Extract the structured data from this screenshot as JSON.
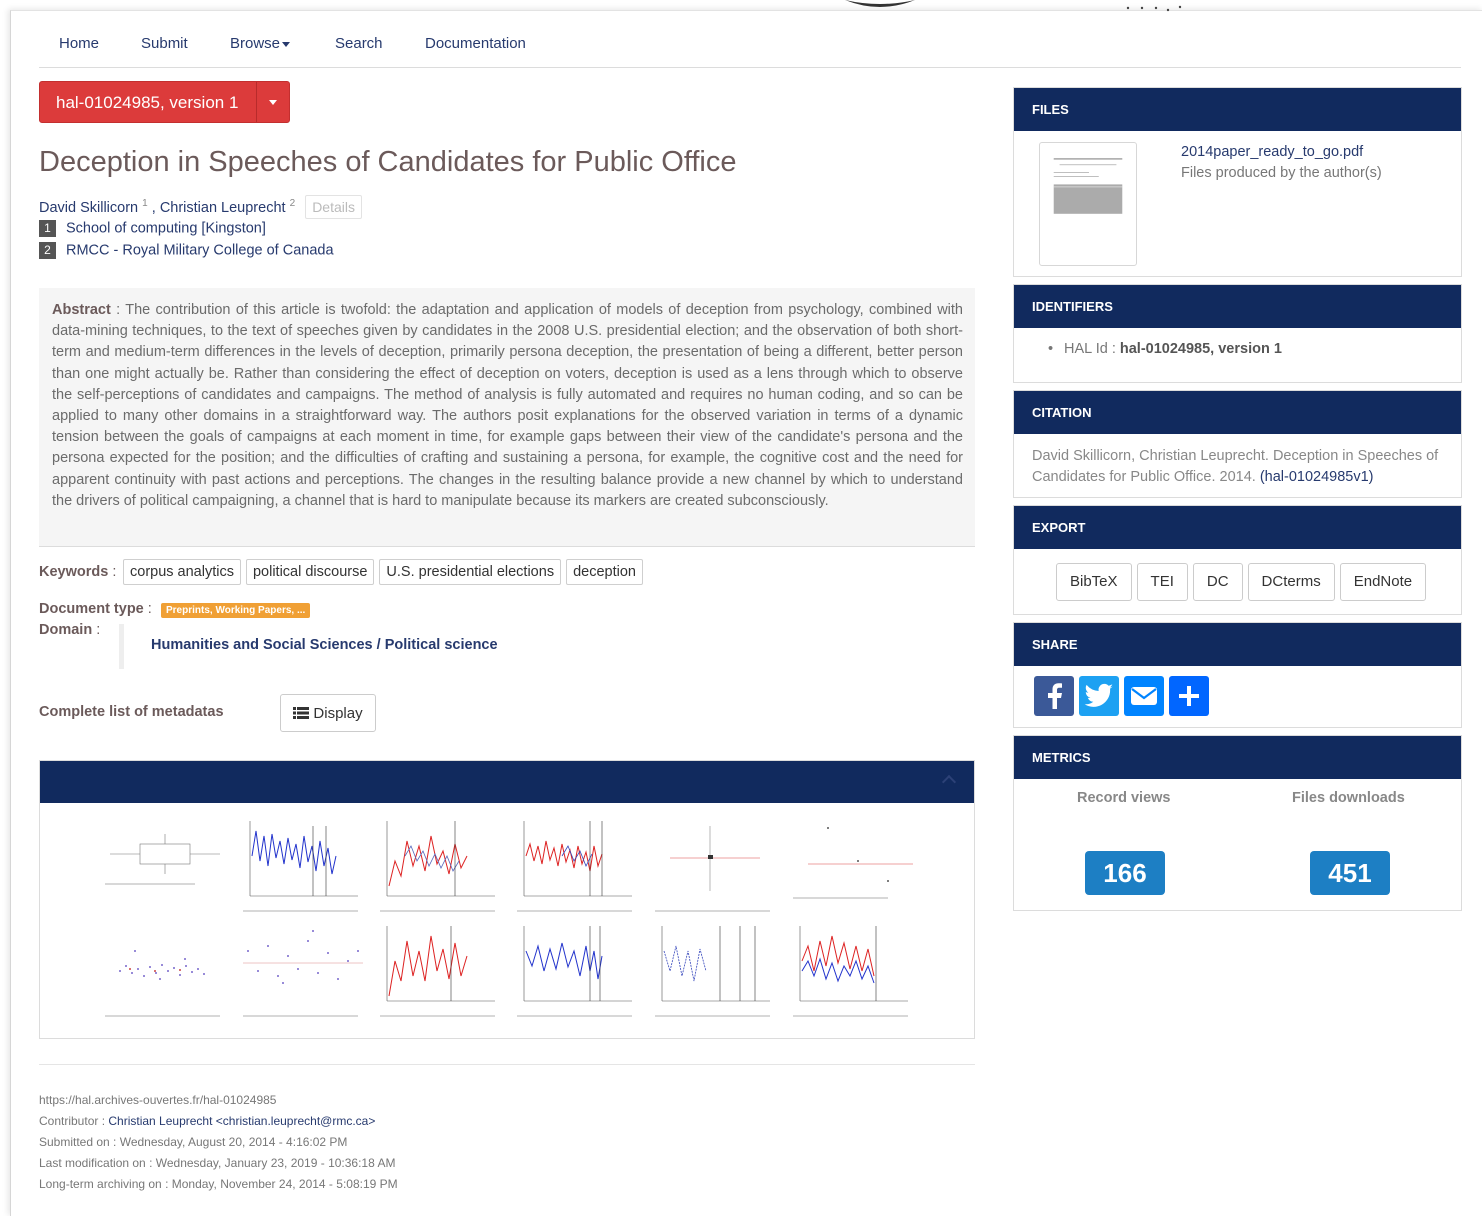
{
  "nav": {
    "home": "Home",
    "submit": "Submit",
    "browse": "Browse",
    "search": "Search",
    "documentation": "Documentation"
  },
  "version_button": "hal-01024985, version 1",
  "title": "Deception in Speeches of Candidates for Public Office",
  "authors": [
    {
      "name": "David Skillicorn",
      "sup": "1"
    },
    {
      "name": "Christian Leuprecht",
      "sup": "2"
    }
  ],
  "authors_sep": " , ",
  "details_label": "Details",
  "affiliations": [
    {
      "num": "1",
      "name": "School of computing [Kingston]"
    },
    {
      "num": "2",
      "name": "RMCC - Royal Military College of Canada"
    }
  ],
  "abstract": {
    "label": "Abstract",
    "sep": " : ",
    "text": "The contribution of this article is twofold: the adaptation and application of models of deception from psychology, combined with data-mining techniques, to the text of speeches given by candidates in the 2008 U.S. presidential election; and the observation of both short-term and medium-term differences in the levels of deception, primarily persona deception, the presentation of being a different, better person than one might actually be. Rather than considering the effect of deception on voters, deception is used as a lens through which to observe the self-perceptions of candidates and campaigns. The method of analysis is fully automated and requires no human coding, and so can be applied to many other domains in a straightforward way. The authors posit explanations for the observed variation in terms of a dynamic tension between the goals of campaigns at each moment in time, for example gaps between their view of the candidate's persona and the persona expected for the position; and the difficulties of crafting and sustaining a persona, for example, the cognitive cost and the need for apparent continuity with past actions and perceptions. The changes in the resulting balance provide a new channel by which to understand the drivers of political campaigning, a channel that is hard to manipulate because its markers are created subconsciously."
  },
  "keywords_label": "Keywords",
  "label_sep": " :",
  "keywords": [
    "corpus analytics",
    "political discourse",
    "U.S. presidential elections",
    "deception"
  ],
  "doctype_label": "Document type",
  "doctype_value": "Preprints, Working Papers, ...",
  "domain_label": "Domain",
  "domain_value": {
    "main": "Humanities and Social Sciences",
    "sep": " / ",
    "sub": "Political science"
  },
  "metadata_label": "Complete list of metadatas",
  "display_label": "Display",
  "footer": {
    "url": "https://hal.archives-ouvertes.fr/hal-01024985",
    "contributor_label": "Contributor : ",
    "contributor_value": "Christian Leuprecht <christian.leuprecht@rmc.ca>",
    "submitted_label": "Submitted on : ",
    "submitted_value": "Wednesday, August 20, 2014 - 4:16:02 PM",
    "lastmod_label": "Last modification on : ",
    "lastmod_value": "Wednesday, January 23, 2019 - 10:36:18 AM",
    "archiving_label": "Long-term archiving on : ",
    "archiving_value": "Monday, November 24, 2014 - 5:08:19 PM"
  },
  "files": {
    "heading": "FILES",
    "filename": "2014paper_ready_to_go.pdf",
    "subtitle": "Files produced by the author(s)"
  },
  "identifiers": {
    "heading": "IDENTIFIERS",
    "label": "HAL Id : ",
    "value": "hal-01024985, version 1"
  },
  "citation": {
    "heading": "CITATION",
    "text": "David Skillicorn, Christian Leuprecht. Deception in Speeches of Candidates for Public Office. 2014. ",
    "link": "(hal-01024985v1)"
  },
  "export": {
    "heading": "EXPORT",
    "buttons": [
      "BibTeX",
      "TEI",
      "DC",
      "DCterms",
      "EndNote"
    ]
  },
  "share": {
    "heading": "SHARE",
    "icons": [
      {
        "name": "facebook-icon",
        "color": "#3b5998"
      },
      {
        "name": "twitter-icon",
        "color": "#1da1f2"
      },
      {
        "name": "email-icon",
        "color": "#0084ff"
      },
      {
        "name": "add-share-icon",
        "color": "#0166ff"
      }
    ]
  },
  "metrics": {
    "heading": "METRICS",
    "views_label": "Record views",
    "views_value": "166",
    "downloads_label": "Files downloads",
    "downloads_value": "451"
  },
  "colors": {
    "accent_navy": "#112a5e",
    "version_red": "#dc3b3b",
    "metric_blue": "#1d7fc4",
    "badge_orange": "#f0a035",
    "link": "#273a6e"
  }
}
